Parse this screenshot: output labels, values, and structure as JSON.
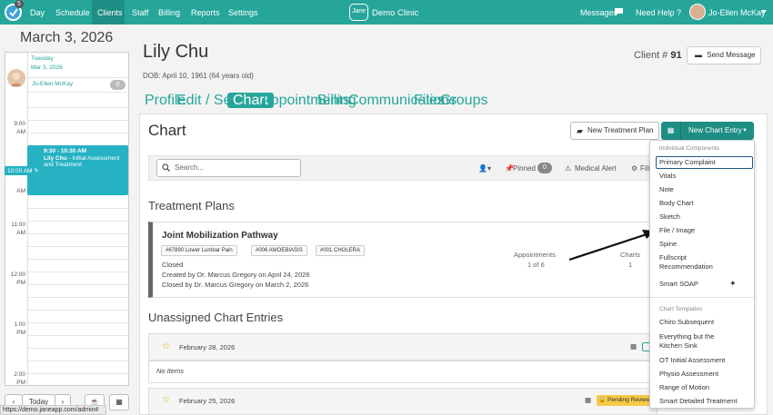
{
  "nav": {
    "badge_count": "5",
    "items": [
      "Day",
      "Schedule",
      "Clients",
      "Staff",
      "Billing",
      "Reports",
      "Settings"
    ],
    "active": "Clients",
    "brand_logo": "Jane",
    "clinic": "Demo Clinic",
    "messages": "Messages",
    "help": "Need Help ?",
    "user": "Jo-Ellen McKay"
  },
  "sidebar": {
    "date": "March 3, 2026",
    "day_label": "Tuesday",
    "day_date": "Mar 3, 2026",
    "staff_name": "Jo-Ellen McKay",
    "staff_count": "0",
    "times": [
      {
        "h": "9:00",
        "p": "AM"
      },
      {
        "h": "10:00",
        "p": "AM"
      },
      {
        "h": "11:00",
        "p": "AM"
      },
      {
        "h": "12:00",
        "p": "PM"
      },
      {
        "h": "1:00",
        "p": "PM"
      },
      {
        "h": "2:00",
        "p": "PM"
      }
    ],
    "now_label": "10:00 AM",
    "appt_time": "9:30 - 10:30 AM",
    "appt_client": "Lily Chu",
    "appt_desc": "- Initial Assessment and Treatment",
    "today_button": "Today",
    "status_url": "https://demo.janeapp.com/admin#"
  },
  "client": {
    "name": "Lily Chu",
    "dob": "DOB: April 10, 1961 (64 years old)",
    "client_label": "Client #",
    "client_number": "91",
    "send_message": "Send Message"
  },
  "tabs": [
    "Profile",
    "Edit / Settings",
    "Chart",
    "Appointments",
    "Billing",
    "Communications",
    "Files",
    "Groups"
  ],
  "chart": {
    "title": "Chart",
    "new_treatment_plan": "New Treatment Plan",
    "new_chart_entry": "New Chart Entry",
    "search_placeholder": "Search...",
    "pinned_label": "Pinned",
    "pinned_count": "0",
    "medical_alert": "Medical Alert",
    "filter_label": "Filt"
  },
  "treatment_plans": {
    "heading": "Treatment Plans",
    "plan": {
      "name": "Joint Mobilization Pathway",
      "tags": [
        "#67890 Lower Lumbar Pain",
        "#006 AMOEBIASIS",
        "#001 CHOLERA"
      ],
      "status": "Closed",
      "created": "Created by Dr. Marcus Gregory on April 24, 2026",
      "closed": "Closed by Dr. Marcus Gregory on March 2, 2026",
      "appointments_label": "Appointments",
      "appointments_value": "1 of 6",
      "charts_label": "Charts",
      "charts_value": "1"
    }
  },
  "unassigned": {
    "heading": "Unassigned Chart Entries",
    "entries": [
      {
        "date": "February 28, 2026",
        "empty": "No Items"
      },
      {
        "date": "February 25, 2026",
        "status": "Pending Review"
      }
    ]
  },
  "dropdown": {
    "components_header": "Individual Components",
    "components": [
      "Primary Complaint",
      "Vitals",
      "Note",
      "Body Chart",
      "Sketch",
      "File / Image",
      "Spine",
      "Fullscript Recommendation",
      "Smart SOAP"
    ],
    "templates_header": "Chart Templates",
    "templates": [
      "Chiro Subsequent",
      "Everything but the Kitchen Sink",
      "OT Initial Assessment",
      "Physio Assessment",
      "Range of Motion",
      "Smart Detailed Treatment"
    ]
  },
  "colors": {
    "primary": "#26a69a",
    "appointment": "#26b2c2",
    "pending": "#f7c948"
  }
}
